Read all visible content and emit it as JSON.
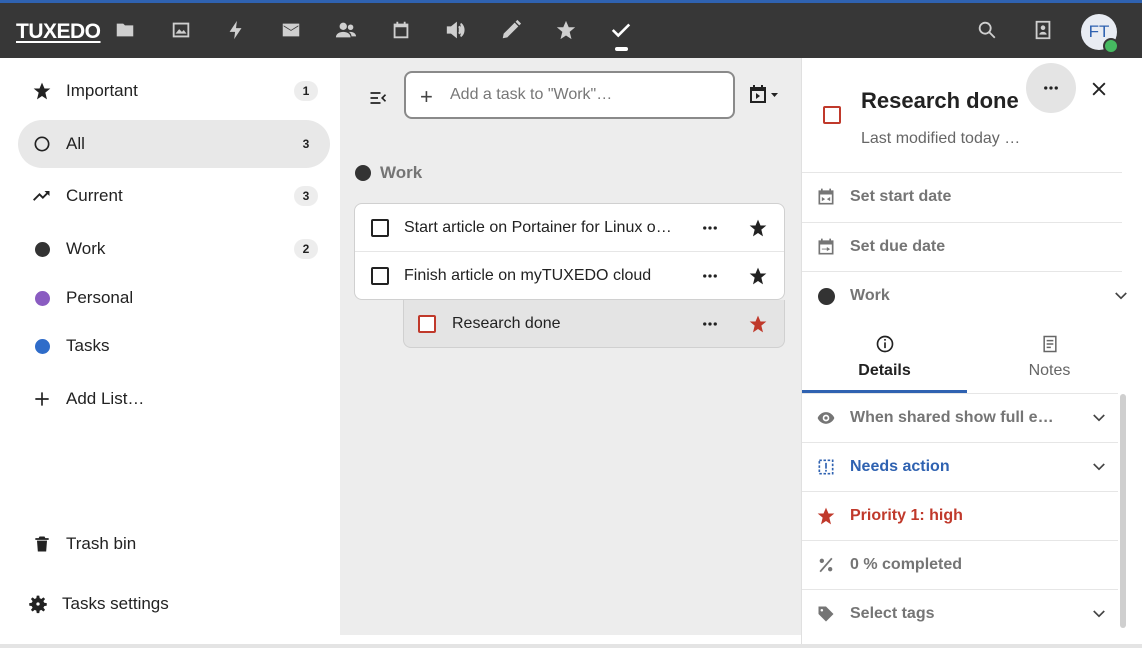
{
  "topbar": {
    "logo": "TUXEDO",
    "apps": [
      {
        "icon": "files-icon"
      },
      {
        "icon": "photos-icon"
      },
      {
        "icon": "activity-icon"
      },
      {
        "icon": "mail-icon"
      },
      {
        "icon": "contacts-icon"
      },
      {
        "icon": "calendar-icon"
      },
      {
        "icon": "announcements-icon"
      },
      {
        "icon": "notes-icon"
      },
      {
        "icon": "favorites-icon"
      },
      {
        "icon": "tasks-icon",
        "active": true
      }
    ],
    "avatar_initials": "FT"
  },
  "sidebar": {
    "items": [
      {
        "label": "Important",
        "count": "1",
        "icon": "star-icon"
      },
      {
        "label": "All",
        "count": "3",
        "icon": "circle-icon",
        "selected": true
      },
      {
        "label": "Current",
        "count": "3",
        "icon": "trending-icon"
      },
      {
        "label": "Work",
        "count": "2",
        "color": "#333333"
      },
      {
        "label": "Personal",
        "color": "#8a5cc1"
      },
      {
        "label": "Tasks",
        "color": "#2f6cc9"
      },
      {
        "label": "Add List…",
        "icon": "plus-icon"
      }
    ],
    "trash_label": "Trash bin",
    "settings_label": "Tasks settings"
  },
  "main": {
    "add_task_placeholder": "Add a task to \"Work\"…",
    "group_title": "Work",
    "tasks": [
      {
        "title": "Start article on Portainer for Linux on myTUXEDO",
        "starred": true
      },
      {
        "title": "Finish article on myTUXEDO cloud",
        "starred": true
      }
    ],
    "subtask": {
      "title": "Research done",
      "starred": true,
      "priority_color": "#c0392b"
    }
  },
  "details": {
    "title": "Research done",
    "modified": "Last modified today …",
    "start_date": "Set start date",
    "due_date": "Set due date",
    "calendar": "Work",
    "tabs": {
      "details": "Details",
      "notes": "Notes"
    },
    "class_label": "When shared show full event",
    "status_label": "Needs action",
    "priority_label": "Priority 1: high",
    "percent_label": "0 % completed",
    "tags_label": "Select tags",
    "colors": {
      "status": "#2f62b1",
      "priority": "#c0392b"
    }
  }
}
